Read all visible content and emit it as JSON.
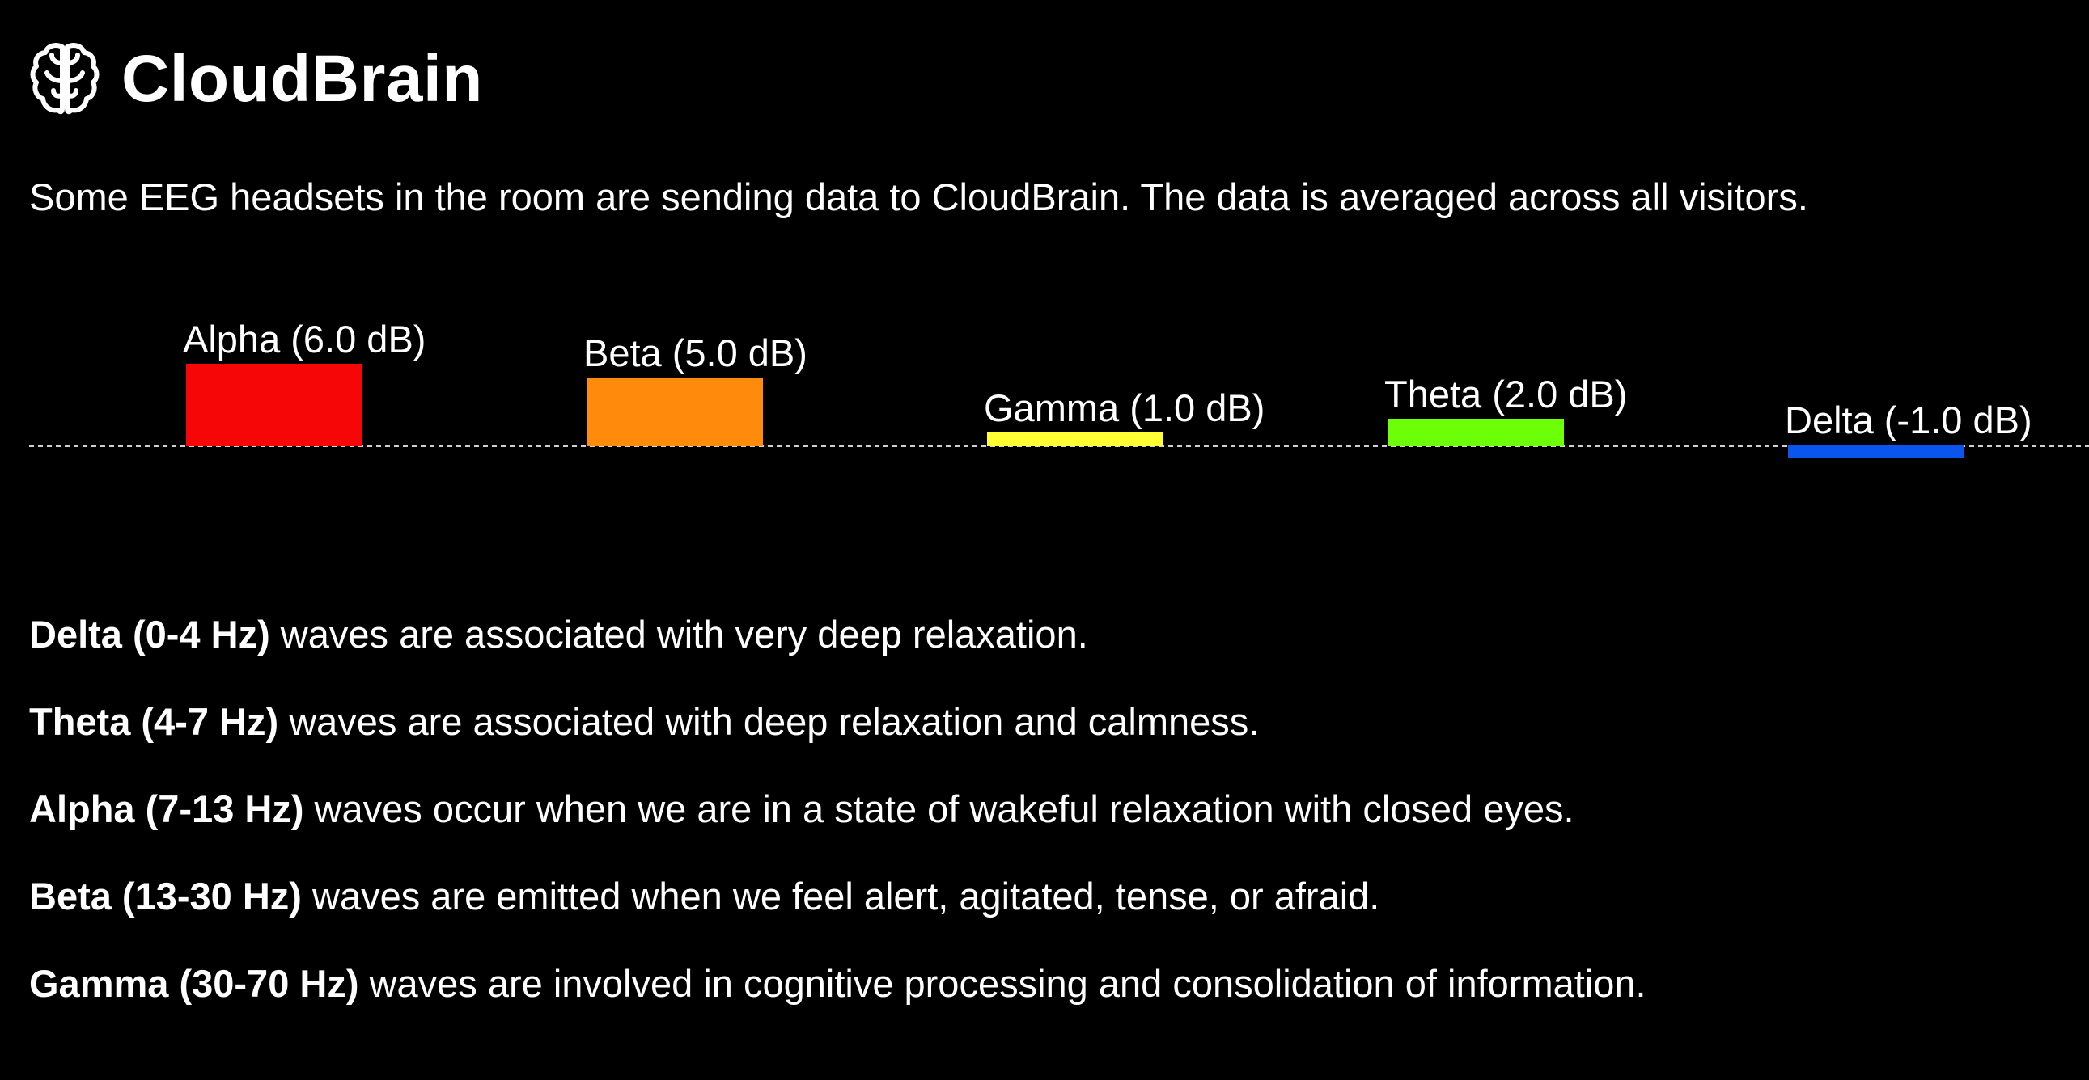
{
  "app": {
    "title": "CloudBrain",
    "icon": "brain-icon"
  },
  "intro_text": "Some EEG headsets in the room are sending data to CloudBrain. The data is averaged across all visitors.",
  "chart_data": {
    "type": "bar",
    "categories": [
      "Alpha",
      "Beta",
      "Gamma",
      "Theta",
      "Delta"
    ],
    "values": [
      6.0,
      5.0,
      1.0,
      2.0,
      -1.0
    ],
    "unit": "dB",
    "data_labels": [
      "Alpha (6.0 dB)",
      "Beta (5.0 dB)",
      "Gamma (1.0 dB)",
      "Theta (2.0 dB)",
      "Delta (-1.0 dB)"
    ],
    "colors": [
      "#f60606",
      "#ff8a0c",
      "#ffff33",
      "#6cff08",
      "#0a55ee"
    ],
    "baseline": 0,
    "baseline_style": "dashed",
    "title": "",
    "xlabel": "",
    "ylabel": "",
    "grid": false,
    "legend": "none"
  },
  "descriptions": [
    {
      "term": "Delta (0-4 Hz)",
      "text": " waves are associated with very deep relaxation."
    },
    {
      "term": "Theta (4-7 Hz)",
      "text": " waves are associated with deep relaxation and calmness."
    },
    {
      "term": "Alpha (7-13 Hz)",
      "text": " waves occur when we are in a state of wakeful relaxation with closed eyes."
    },
    {
      "term": "Beta (13-30 Hz)",
      "text": " waves are emitted when we feel alert, agitated, tense, or afraid."
    },
    {
      "term": "Gamma (30-70 Hz)",
      "text": " waves are involved in cognitive processing and consolidation of information."
    }
  ]
}
